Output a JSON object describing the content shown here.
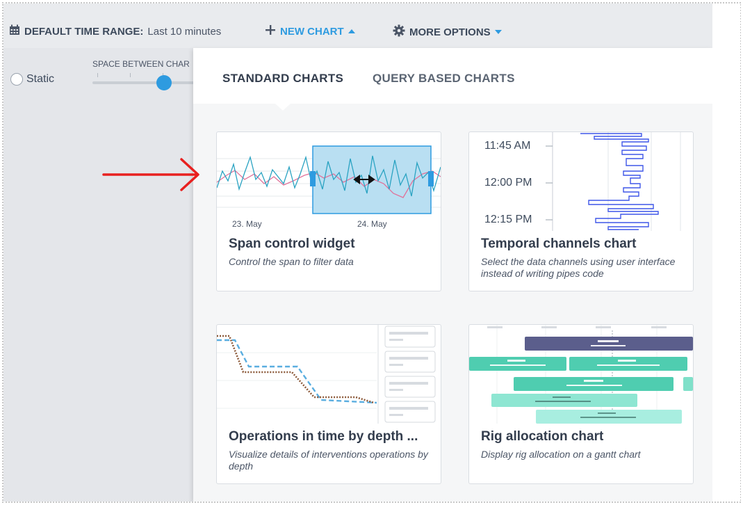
{
  "topbar": {
    "time_range_label": "DEFAULT TIME RANGE:",
    "time_range_value": "Last 10 minutes",
    "new_chart_label": "NEW CHART",
    "more_options_label": "MORE OPTIONS"
  },
  "left_panel": {
    "static_label": "Static",
    "space_between_label": "SPACE BETWEEN CHAR"
  },
  "dropdown": {
    "tabs": [
      {
        "label": "STANDARD CHARTS",
        "active": true
      },
      {
        "label": "QUERY BASED CHARTS",
        "active": false
      }
    ],
    "cards": [
      {
        "title": "Span control widget",
        "description": "Control the span to filter data",
        "thumb_labels": [
          "23. May",
          "24. May"
        ]
      },
      {
        "title": "Temporal channels chart",
        "description": "Select the data channels using user interface instead of writing pipes code",
        "thumb_labels": [
          "11:45 AM",
          "12:00 PM",
          "12:15 PM"
        ]
      },
      {
        "title": "Operations in time by depth ...",
        "description": "Visualize details of interventions operations by depth"
      },
      {
        "title": "Rig allocation chart",
        "description": "Display rig allocation on a gantt chart"
      }
    ]
  },
  "colors": {
    "accent": "#2e9be0",
    "annotation_arrow": "#e8201f"
  }
}
